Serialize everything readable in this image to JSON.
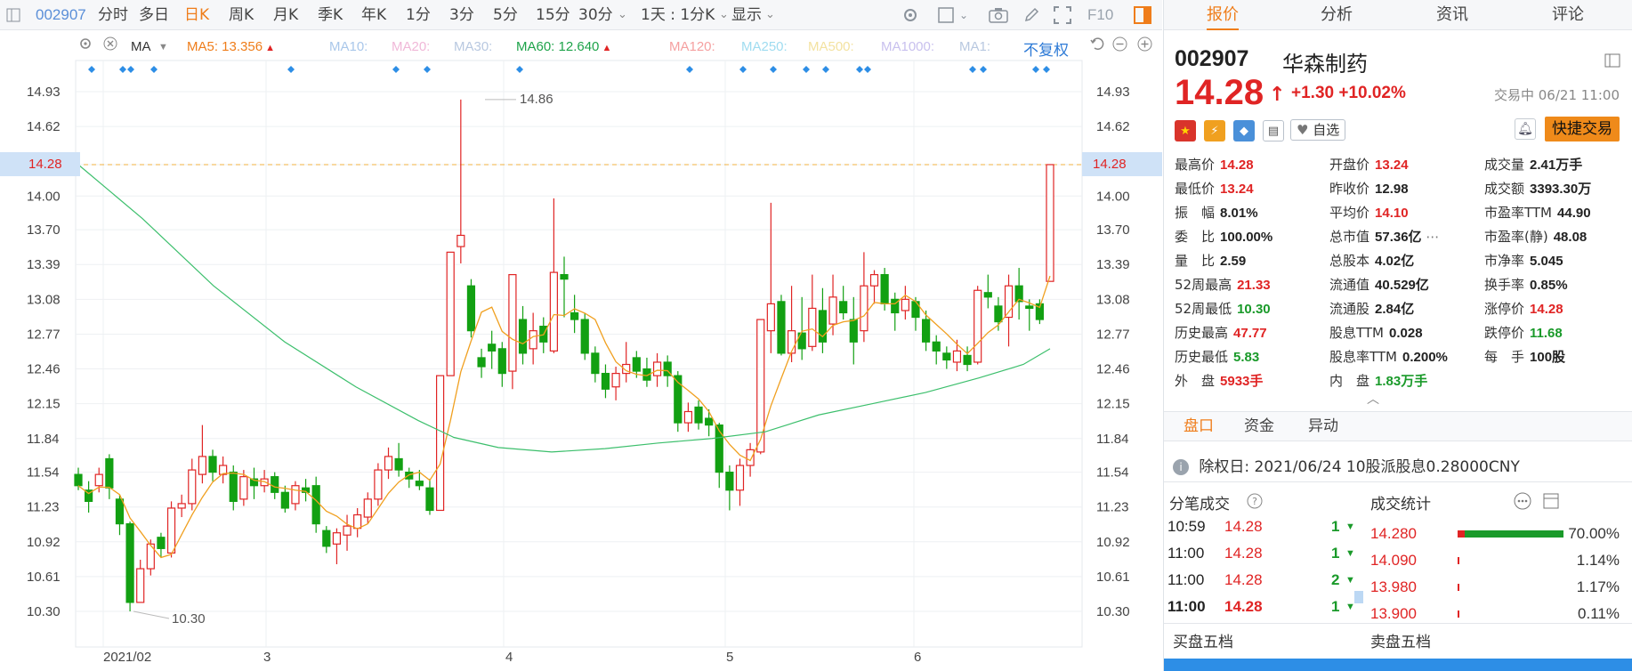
{
  "toolbar": {
    "code": "002907",
    "items": [
      "分时",
      "多日",
      "日K",
      "周K",
      "月K",
      "季K",
      "年K",
      "1分",
      "3分",
      "5分",
      "15分",
      "30分"
    ],
    "active": "日K",
    "range": "1天 : 1分K",
    "display": "显示",
    "f10": "F10"
  },
  "ma_bar": {
    "ma": "MA",
    "items": [
      {
        "label": "MA5: 13.356",
        "color": "#ef7d1a",
        "arrow": "▲"
      },
      {
        "label": "MA10:",
        "color": "#a9c7ea"
      },
      {
        "label": "MA20:",
        "color": "#f0b8d8"
      },
      {
        "label": "MA30:",
        "color": "#b8c8e0"
      },
      {
        "label": "MA60: 12.640",
        "color": "#1ea34a",
        "arrow": "▲"
      },
      {
        "label": "MA120:",
        "color": "#f5a0a0"
      },
      {
        "label": "MA250:",
        "color": "#9fdcf0"
      },
      {
        "label": "MA500:",
        "color": "#f3e2a0"
      },
      {
        "label": "MA1000:",
        "color": "#c8c0ee"
      },
      {
        "label": "MA1:",
        "color": "#b8c8e0"
      }
    ],
    "fuquan": "不复权"
  },
  "chart_data": {
    "type": "candlestick",
    "y_ticks": [
      "14.93",
      "14.62",
      "14.28",
      "14.00",
      "13.70",
      "13.39",
      "13.08",
      "12.77",
      "12.46",
      "12.15",
      "11.84",
      "11.54",
      "11.23",
      "10.92",
      "10.61",
      "10.30"
    ],
    "x_labels": [
      "2021/02",
      "3",
      "4",
      "5",
      "6"
    ],
    "last_price": "14.28",
    "max_label": "14.86",
    "min_label": "10.30",
    "candles": [
      [
        11.52,
        11.42,
        11.58,
        11.38
      ],
      [
        11.38,
        11.28,
        11.46,
        11.18
      ],
      [
        11.42,
        11.52,
        11.58,
        11.36
      ],
      [
        11.66,
        11.4,
        11.7,
        11.3
      ],
      [
        11.3,
        11.08,
        11.34,
        10.98
      ],
      [
        11.08,
        10.38,
        11.1,
        10.3
      ],
      [
        10.38,
        10.68,
        10.76,
        10.38
      ],
      [
        10.68,
        10.9,
        10.94,
        10.62
      ],
      [
        10.96,
        10.86,
        11.0,
        10.78
      ],
      [
        10.82,
        11.22,
        11.28,
        10.78
      ],
      [
        11.22,
        11.26,
        11.34,
        11.14
      ],
      [
        11.26,
        11.56,
        11.66,
        11.2
      ],
      [
        11.52,
        11.68,
        11.96,
        11.44
      ],
      [
        11.68,
        11.54,
        11.74,
        11.46
      ],
      [
        11.52,
        11.6,
        11.68,
        11.44
      ],
      [
        11.54,
        11.28,
        11.6,
        11.2
      ],
      [
        11.3,
        11.5,
        11.56,
        11.24
      ],
      [
        11.48,
        11.42,
        11.58,
        11.3
      ],
      [
        11.42,
        11.48,
        11.56,
        11.36
      ],
      [
        11.5,
        11.36,
        11.54,
        11.3
      ],
      [
        11.36,
        11.22,
        11.42,
        11.18
      ],
      [
        11.26,
        11.42,
        11.46,
        11.2
      ],
      [
        11.4,
        11.36,
        11.48,
        11.28
      ],
      [
        11.42,
        11.08,
        11.5,
        11.0
      ],
      [
        11.02,
        10.88,
        11.06,
        10.82
      ],
      [
        10.9,
        11.0,
        11.04,
        10.72
      ],
      [
        10.98,
        11.06,
        11.16,
        10.84
      ],
      [
        11.04,
        11.16,
        11.22,
        10.96
      ],
      [
        11.14,
        11.3,
        11.36,
        11.08
      ],
      [
        11.3,
        11.56,
        11.62,
        11.24
      ],
      [
        11.56,
        11.68,
        11.76,
        11.48
      ],
      [
        11.66,
        11.56,
        11.8,
        11.5
      ],
      [
        11.54,
        11.48,
        11.58,
        11.4
      ],
      [
        11.46,
        11.42,
        11.56,
        11.38
      ],
      [
        11.4,
        11.2,
        11.48,
        11.16
      ],
      [
        11.2,
        12.4,
        12.4,
        11.2
      ],
      [
        12.4,
        13.5,
        13.5,
        12.4
      ],
      [
        13.55,
        13.65,
        14.86,
        13.4
      ],
      [
        13.2,
        12.8,
        13.26,
        12.74
      ],
      [
        12.56,
        12.48,
        12.64,
        12.38
      ],
      [
        12.68,
        12.62,
        12.8,
        12.46
      ],
      [
        12.64,
        12.42,
        12.7,
        12.3
      ],
      [
        12.44,
        13.3,
        13.3,
        12.28
      ],
      [
        12.9,
        12.6,
        13.02,
        12.5
      ],
      [
        12.64,
        12.8,
        12.96,
        12.5
      ],
      [
        12.84,
        12.7,
        12.92,
        12.6
      ],
      [
        12.62,
        13.32,
        13.98,
        12.6
      ],
      [
        13.3,
        13.26,
        13.46,
        12.92
      ],
      [
        12.96,
        12.9,
        13.12,
        12.78
      ],
      [
        12.9,
        12.6,
        12.96,
        12.54
      ],
      [
        12.6,
        12.42,
        12.66,
        12.34
      ],
      [
        12.42,
        12.28,
        12.5,
        12.2
      ],
      [
        12.3,
        12.42,
        12.48,
        12.18
      ],
      [
        12.42,
        12.5,
        12.7,
        12.34
      ],
      [
        12.56,
        12.44,
        12.62,
        12.38
      ],
      [
        12.46,
        12.36,
        12.56,
        12.3
      ],
      [
        12.4,
        12.52,
        12.6,
        12.3
      ],
      [
        12.52,
        12.4,
        12.58,
        12.3
      ],
      [
        12.4,
        11.98,
        12.44,
        11.9
      ],
      [
        11.98,
        12.08,
        12.16,
        11.9
      ],
      [
        12.12,
        11.98,
        12.18,
        11.92
      ],
      [
        12.02,
        11.96,
        12.1,
        11.86
      ],
      [
        11.96,
        11.54,
        11.98,
        11.4
      ],
      [
        11.54,
        11.38,
        11.6,
        11.2
      ],
      [
        11.38,
        11.6,
        11.66,
        11.24
      ],
      [
        11.6,
        11.74,
        11.8,
        11.5
      ],
      [
        11.72,
        12.9,
        12.9,
        11.7
      ],
      [
        12.8,
        13.04,
        13.94,
        12.6
      ],
      [
        13.06,
        12.6,
        13.12,
        12.58
      ],
      [
        12.6,
        12.8,
        13.2,
        12.52
      ],
      [
        12.78,
        12.64,
        13.1,
        12.54
      ],
      [
        12.66,
        13.0,
        13.3,
        12.62
      ],
      [
        12.98,
        12.7,
        13.18,
        12.6
      ],
      [
        12.86,
        13.1,
        13.3,
        12.76
      ],
      [
        13.06,
        12.96,
        13.2,
        12.9
      ],
      [
        12.9,
        12.7,
        13.1,
        12.5
      ],
      [
        12.8,
        13.2,
        13.5,
        12.7
      ],
      [
        13.2,
        13.3,
        13.34,
        13.04
      ],
      [
        13.3,
        13.04,
        13.36,
        12.98
      ],
      [
        13.08,
        12.96,
        13.14,
        12.8
      ],
      [
        12.98,
        13.08,
        13.2,
        12.9
      ],
      [
        13.06,
        12.92,
        13.1,
        12.8
      ],
      [
        12.9,
        12.7,
        12.98,
        12.62
      ],
      [
        12.7,
        12.62,
        12.76,
        12.5
      ],
      [
        12.6,
        12.54,
        12.66,
        12.46
      ],
      [
        12.52,
        12.62,
        12.72,
        12.44
      ],
      [
        12.58,
        12.5,
        12.66,
        12.44
      ],
      [
        12.52,
        13.16,
        13.2,
        12.5
      ],
      [
        13.14,
        13.1,
        13.3,
        13.0
      ],
      [
        13.02,
        12.88,
        13.1,
        12.8
      ],
      [
        12.92,
        13.2,
        13.3,
        12.66
      ],
      [
        13.2,
        13.06,
        13.36,
        12.9
      ],
      [
        13.02,
        13.0,
        13.08,
        12.8
      ],
      [
        13.04,
        12.9,
        13.08,
        12.86
      ],
      [
        13.24,
        14.28,
        14.28,
        13.24
      ]
    ]
  },
  "quote": {
    "tabs": [
      "报价",
      "分析",
      "资讯",
      "评论"
    ],
    "active_tab": "报价",
    "code": "002907",
    "name": "华森制药",
    "price": "14.28",
    "change": "+1.30 +10.02%",
    "status": "交易中 06/21 11:00",
    "add_fav": "自选",
    "quick_trade": "快捷交易",
    "rows": [
      [
        {
          "k": "最高价",
          "v": "14.28",
          "c": "red"
        },
        {
          "k": "开盘价",
          "v": "13.24",
          "c": "red"
        },
        {
          "k": "成交量",
          "v": "2.41万手",
          "c": "blk"
        }
      ],
      [
        {
          "k": "最低价",
          "v": "13.24",
          "c": "red"
        },
        {
          "k": "昨收价",
          "v": "12.98",
          "c": "blk"
        },
        {
          "k": "成交额",
          "v": "3393.30万",
          "c": "blk"
        }
      ],
      [
        {
          "k": "振　幅",
          "v": "8.01%",
          "c": "blk"
        },
        {
          "k": "平均价",
          "v": "14.10",
          "c": "red"
        },
        {
          "k": "市盈率TTM",
          "v": "44.90",
          "c": "blk"
        }
      ],
      [
        {
          "k": "委　比",
          "v": "100.00%",
          "c": "blk"
        },
        {
          "k": "总市值",
          "v": "57.36亿",
          "c": "blk"
        },
        {
          "k": "市盈率(静)",
          "v": "48.08",
          "c": "blk"
        }
      ],
      [
        {
          "k": "量　比",
          "v": "2.59",
          "c": "blk"
        },
        {
          "k": "总股本",
          "v": "4.02亿",
          "c": "blk"
        },
        {
          "k": "市净率",
          "v": "5.045",
          "c": "blk"
        }
      ],
      [
        {
          "k": "52周最高",
          "v": "21.33",
          "c": "red"
        },
        {
          "k": "流通值",
          "v": "40.529亿",
          "c": "blk"
        },
        {
          "k": "换手率",
          "v": "0.85%",
          "c": "blk"
        }
      ],
      [
        {
          "k": "52周最低",
          "v": "10.30",
          "c": "green"
        },
        {
          "k": "流通股",
          "v": "2.84亿",
          "c": "blk"
        },
        {
          "k": "涨停价",
          "v": "14.28",
          "c": "red"
        }
      ],
      [
        {
          "k": "历史最高",
          "v": "47.77",
          "c": "red"
        },
        {
          "k": "股息TTM",
          "v": "0.028",
          "c": "blk"
        },
        {
          "k": "跌停价",
          "v": "11.68",
          "c": "green"
        }
      ],
      [
        {
          "k": "历史最低",
          "v": "5.83",
          "c": "green"
        },
        {
          "k": "股息率TTM",
          "v": "0.200%",
          "c": "blk"
        },
        {
          "k": "每　手",
          "v": "100股",
          "c": "blk"
        }
      ],
      [
        {
          "k": "外　盘",
          "v": "5933手",
          "c": "red"
        },
        {
          "k": "内　盘",
          "v": "1.83万手",
          "c": "green"
        },
        {
          "k": "",
          "v": "",
          "c": "blk"
        }
      ]
    ],
    "sub_tabs": [
      "盘口",
      "资金",
      "异动"
    ],
    "ex_right": "除权日: 2021/06/24  10股派股息0.28000CNY",
    "ticks_title": "分笔成交",
    "ticks": [
      {
        "time": "10:59",
        "price": "14.28",
        "vol": "1"
      },
      {
        "time": "11:00",
        "price": "14.28",
        "vol": "1"
      },
      {
        "time": "11:00",
        "price": "14.28",
        "vol": "2"
      },
      {
        "time": "11:00",
        "price": "14.28",
        "vol": "1"
      }
    ],
    "stats_title": "成交统计",
    "stats": [
      {
        "price": "14.280",
        "pct": "70.00%",
        "share": 0.7
      },
      {
        "price": "14.090",
        "pct": "1.14%",
        "share": 0.0114
      },
      {
        "price": "13.980",
        "pct": "1.17%",
        "share": 0.0117
      },
      {
        "price": "13.900",
        "pct": "0.11%",
        "share": 0.0011
      }
    ],
    "buy5": "买盘五档",
    "sell5": "卖盘五档"
  },
  "colors": {
    "up": "#e02424",
    "down": "#12a012",
    "accent": "#ef7d1a",
    "ma5": "#f0a020",
    "ma60": "#3cbf6c"
  }
}
